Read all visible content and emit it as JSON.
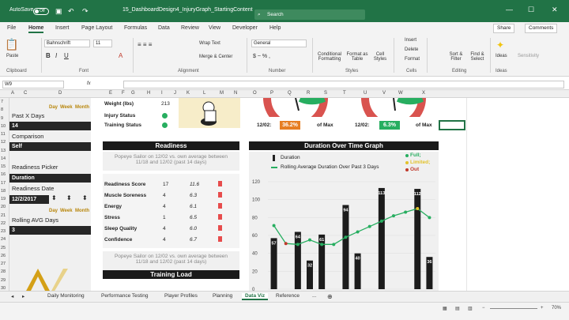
{
  "titlebar": {
    "autosave": "AutoSave",
    "toggle": "Off",
    "filename": "15_DashboardDesign4_InjuryGraph_StartingContent",
    "search": "Search"
  },
  "tabs": [
    "File",
    "Home",
    "Insert",
    "Page Layout",
    "Formulas",
    "Data",
    "Review",
    "View",
    "Developer",
    "Help"
  ],
  "actions": {
    "share": "Share",
    "comments": "Comments"
  },
  "ribbon": {
    "paste": "Paste",
    "clipboard": "Clipboard",
    "font_name": "Bahnschrift",
    "font_size": "11",
    "font": "Font",
    "wrap": "Wrap Text",
    "merge": "Merge & Center",
    "alignment": "Alignment",
    "number_format": "General",
    "number": "Number",
    "cond": "Conditional Formatting",
    "fmt_table": "Format as Table",
    "cell_styles": "Cell Styles",
    "styles": "Styles",
    "insert": "Insert",
    "delete": "Delete",
    "format": "Format",
    "cells": "Cells",
    "sort": "Sort & Filter",
    "find": "Find & Select",
    "editing": "Editing",
    "ideas": "Ideas",
    "sensitivity": "Sensitivity"
  },
  "formula": {
    "namebox": "W9",
    "fx": "fx"
  },
  "columns": [
    "A",
    "C",
    "D",
    "E",
    "F",
    "G",
    "H",
    "I",
    "J",
    "K",
    "L",
    "M",
    "N",
    "O",
    "P",
    "Q",
    "R",
    "S",
    "T",
    "U",
    "V",
    "W",
    "X"
  ],
  "rows": [
    "7",
    "8",
    "9",
    "10",
    "11",
    "12",
    "13",
    "14",
    "15",
    "16",
    "17",
    "18",
    "19",
    "20",
    "21",
    "22",
    "23",
    "24",
    "25",
    "26",
    "27",
    "28",
    "29",
    "30"
  ],
  "left": {
    "day": "Day",
    "week": "Week",
    "month": "Month",
    "past_x": "Past X Days",
    "past_x_val": "14",
    "comparison": "Comparison",
    "comparison_val": "Self",
    "picker": "Readiness Picker",
    "picker_val": "Duration",
    "date_lbl": "Readiness Date",
    "date_val": "12/2/2017",
    "rolling": "Rolling AVG Days",
    "rolling_val": "3"
  },
  "status": {
    "weight_lbl": "Weight (lbs)",
    "weight_val": "213",
    "injury_lbl": "Injury Status",
    "training_lbl": "Training Status"
  },
  "gauges": {
    "date1": "12/02:",
    "pct1": "36.2%",
    "ofmax1": "of Max",
    "date2": "12/02:",
    "pct2": "6.3%",
    "ofmax2": "of Max",
    "orange": "#e67e22",
    "green": "#27ae60"
  },
  "readiness": {
    "title": "Readiness",
    "subtitle": "Popeye Sailor on 12/02 vs. own average between 11/18 and 12/02 (past 14 days)",
    "rows": [
      {
        "name": "Readiness Score",
        "v": "17",
        "avg": "11.6"
      },
      {
        "name": "Muscle Soreness",
        "v": "4",
        "avg": "6.3"
      },
      {
        "name": "Energy",
        "v": "4",
        "avg": "6.1"
      },
      {
        "name": "Stress",
        "v": "1",
        "avg": "6.5"
      },
      {
        "name": "Sleep Quality",
        "v": "4",
        "avg": "6.0"
      },
      {
        "name": "Confidence",
        "v": "4",
        "avg": "6.7"
      }
    ],
    "subtitle2": "Popeye Sailor on 12/02 vs. own average between 11/18 and 12/02 (past 14 days)",
    "training": "Training Load"
  },
  "chart_data": {
    "type": "bar",
    "title": "Duration Over Time Graph",
    "legend": [
      "Duration",
      "Rolling Average Duration Over Past 3 Days"
    ],
    "status_legend": [
      "Full;",
      "Limited;",
      "Out"
    ],
    "status_colors": [
      "#27ae60",
      "#e2c22b",
      "#c0392b"
    ],
    "ylim": [
      0,
      120
    ],
    "yticks": [
      "0",
      "20",
      "40",
      "60",
      "80",
      "100",
      "120"
    ],
    "values": [
      57,
      null,
      64,
      32,
      61,
      null,
      94,
      40,
      null,
      113,
      null,
      null,
      112,
      36
    ],
    "rolling": [
      71,
      null,
      null,
      null,
      null,
      null,
      null,
      null,
      null,
      null,
      null,
      null,
      null,
      null
    ],
    "line": [
      71,
      51,
      50,
      55,
      50,
      50,
      58,
      64,
      70,
      76,
      82,
      86,
      90,
      80
    ],
    "markers": [
      "g",
      "r",
      "g",
      "g",
      "g",
      "g",
      "g",
      "g",
      "g",
      "g",
      "g",
      "g",
      "y",
      "g"
    ]
  },
  "sheettabs": [
    "Daily Monitoring",
    "Performance Testing",
    "Player Profiles",
    "Planning",
    "Data Viz",
    "Reference",
    "..."
  ],
  "zoom": "70%"
}
